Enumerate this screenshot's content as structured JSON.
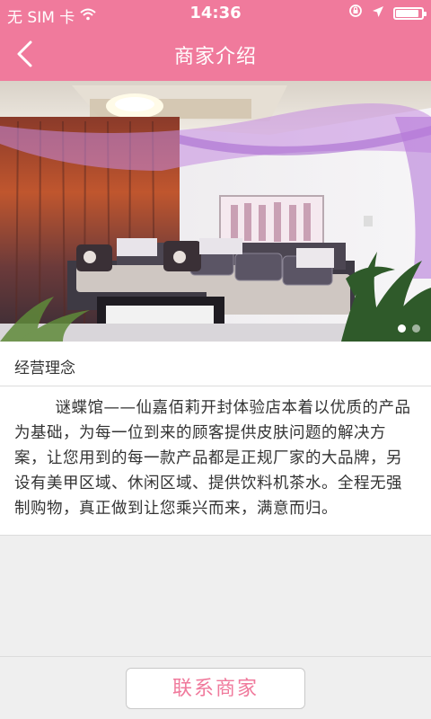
{
  "status_bar": {
    "carrier": "无 SIM 卡",
    "time": "14:36",
    "battery_level": 0.9
  },
  "nav": {
    "title": "商家介绍",
    "back_icon": "chevron-left-icon"
  },
  "banner": {
    "slide_count": 2,
    "active_slide": 1,
    "image_subject": "salon-lounge-photo"
  },
  "section": {
    "title": "经营理念"
  },
  "description": {
    "text": "谜蝶馆——仙嘉佰莉开封体验店本着以优质的产品为基础，为每一位到来的顾客提供皮肤问题的解决方案，让您用到的每一款产品都是正规厂家的大品牌，另设有美甲区域、休闲区域、提供饮料机茶水。全程无强制购物，真正做到让您乘兴而来，满意而归。"
  },
  "footer": {
    "contact_label": "联系商家"
  },
  "colors": {
    "accent": "#f07a9c",
    "background": "#efefef"
  }
}
